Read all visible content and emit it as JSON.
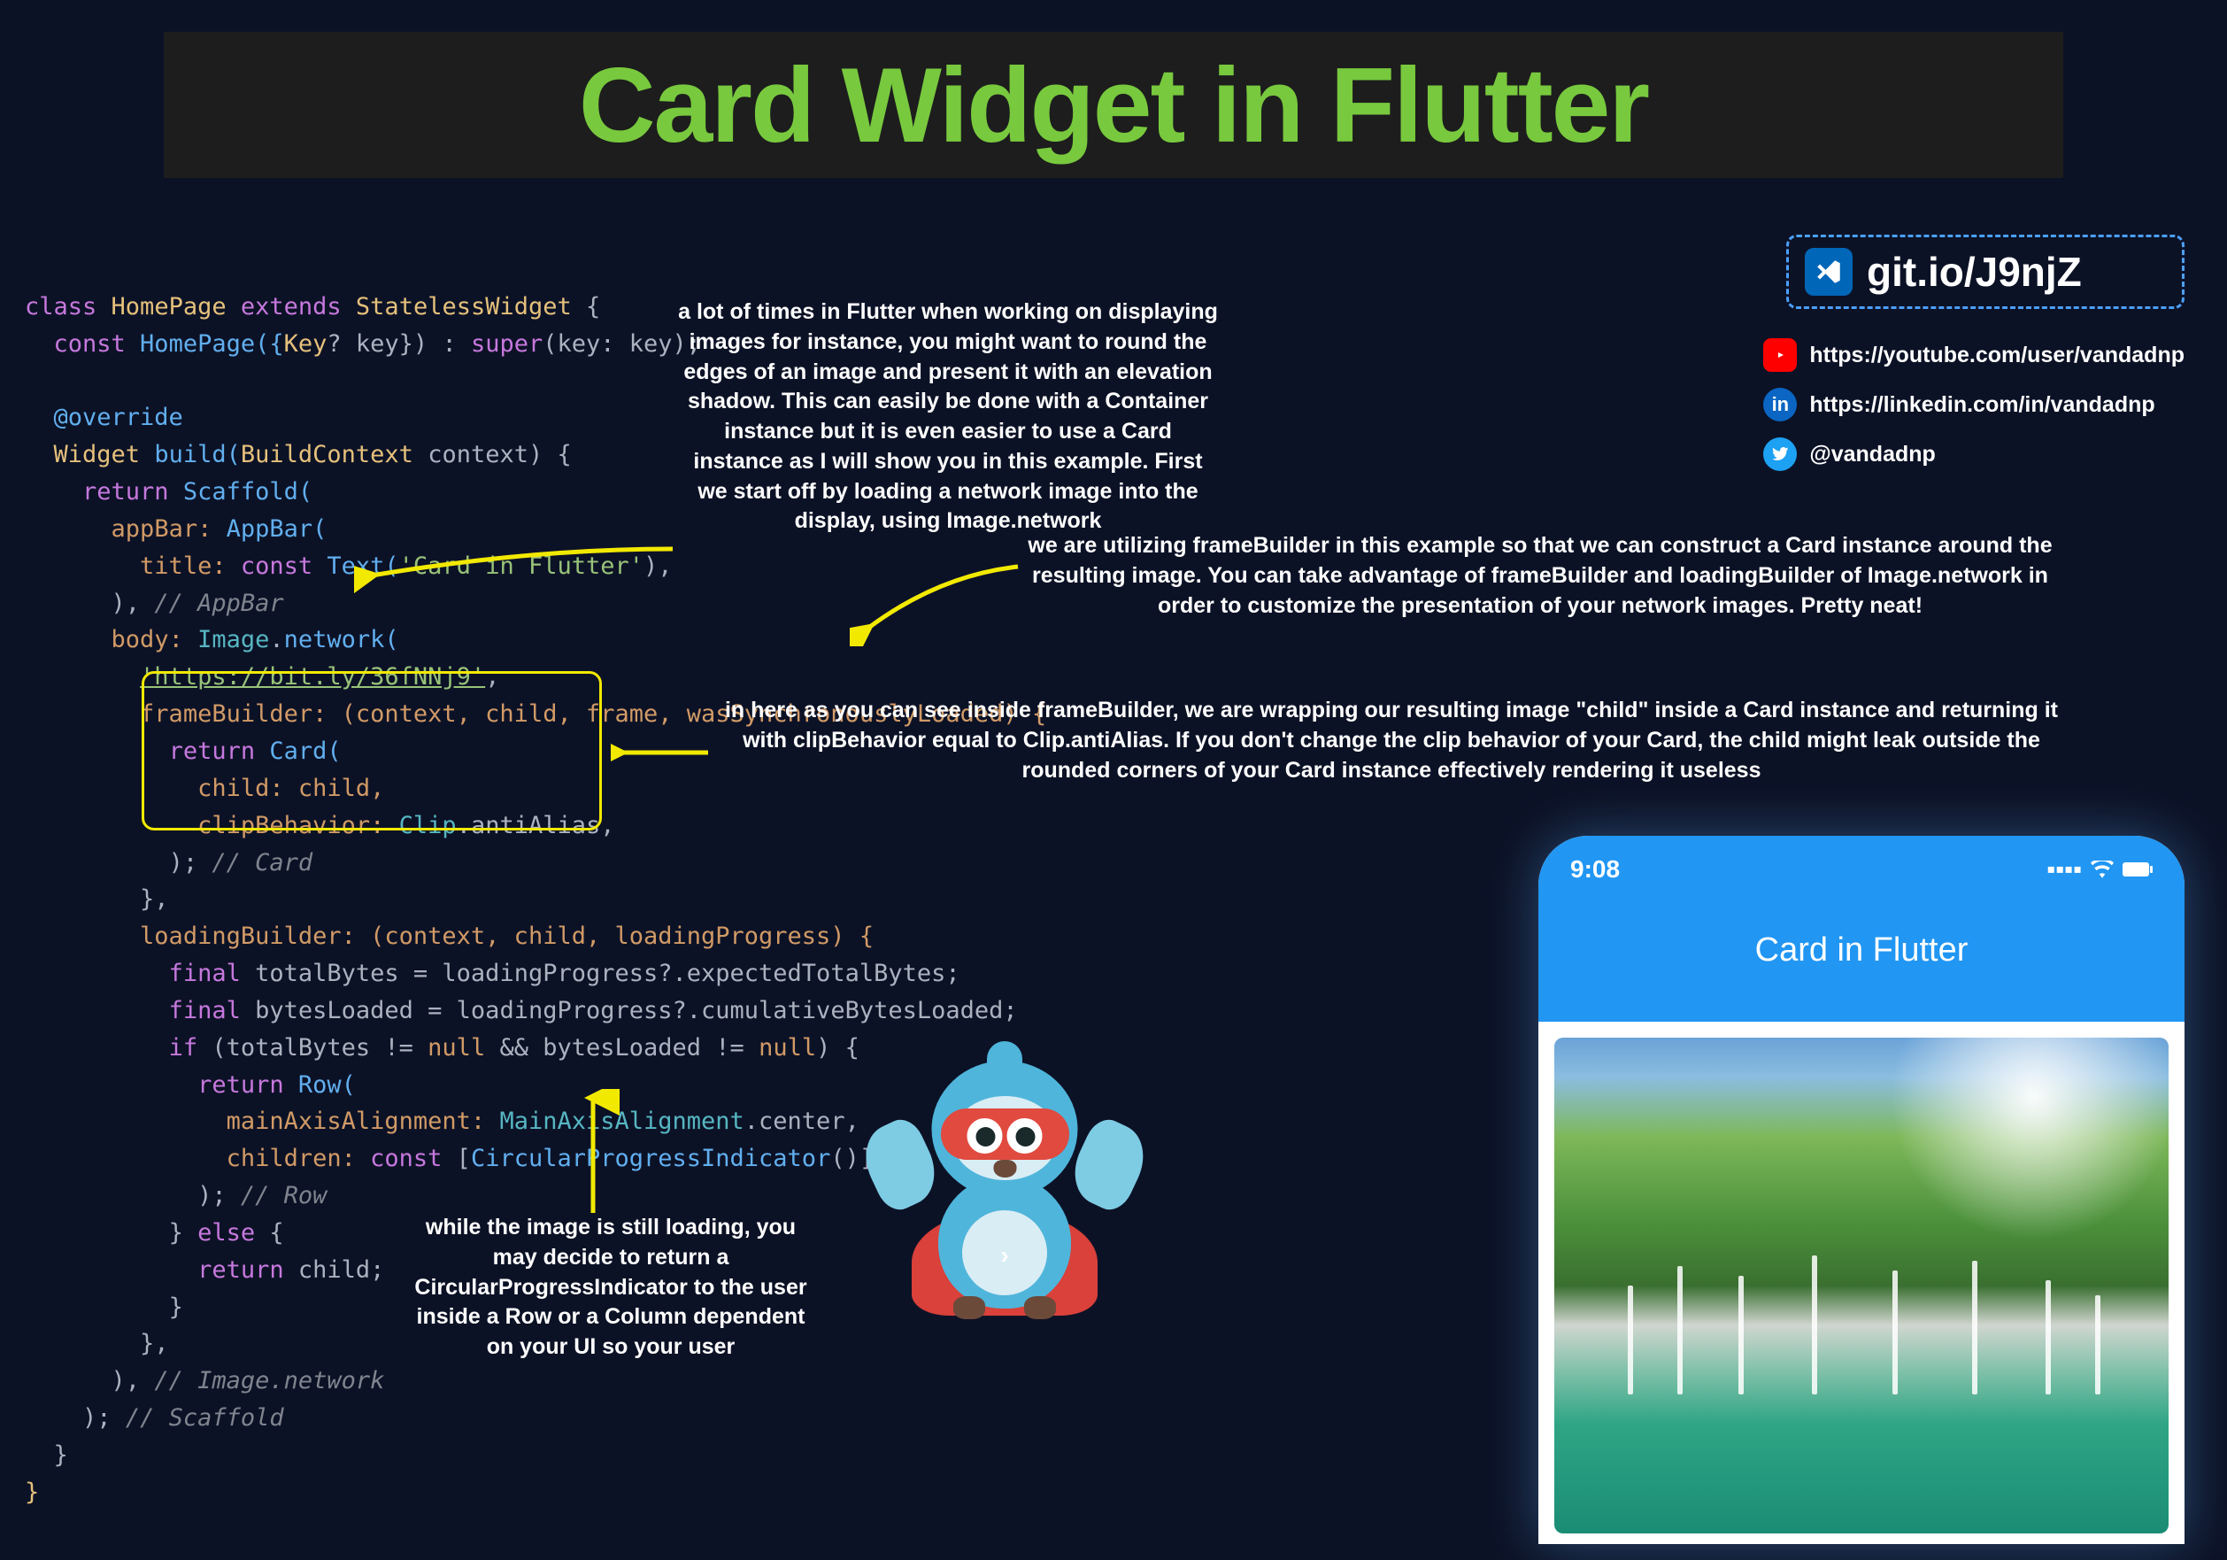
{
  "title": "Card Widget in Flutter",
  "annotations": {
    "a1": "a lot of times in Flutter when working on displaying images for instance, you might want to round the edges of an image and present it with an elevation shadow. This can easily be done with a Container instance but it is even easier to use a Card instance as I will show you in this example. First we start off by loading a network image into the display, using Image.network",
    "a2": "we are utilizing frameBuilder in this example so that we can construct a Card instance around the resulting image. You can take advantage of frameBuilder and loadingBuilder of Image.network in order to customize the presentation of your network images. Pretty neat!",
    "a3": "in here as you can see inside frameBuilder, we are wrapping our resulting image \"child\" inside a Card instance and returning it with clipBehavior equal to Clip.antiAlias. If you don't change the clip behavior of your Card, the child might leak outside the rounded corners of your Card instance effectively rendering it useless",
    "a4": "while the image is still loading, you may decide to return a CircularProgressIndicator to the user inside a Row or a Column dependent on your UI so your user"
  },
  "link_box": "git.io/J9njZ",
  "socials": {
    "youtube": "https://youtube.com/user/vandadnp",
    "linkedin": "https://linkedin.com/in/vandadnp",
    "twitter": "@vandadnp"
  },
  "phone": {
    "time": "9:08",
    "appbar_title": "Card in Flutter"
  },
  "code": {
    "l1_class": "class",
    "l1_HomePage": "HomePage",
    "l1_extends": "extends",
    "l1_Stateless": "StatelessWidget",
    "l1_brace": " {",
    "l2_const": "const",
    "l2_ctor": " HomePage({",
    "l2_Key": "Key",
    "l2_q": "?",
    "l2_key": " key}) : ",
    "l2_super": "super",
    "l2_args": "(key: key);",
    "l3": "",
    "l4_override": "@override",
    "l5_Widget": "Widget",
    "l5_build": " build(",
    "l5_BC": "BuildContext",
    "l5_ctx": " context) {",
    "l6_return": "return",
    "l6_Scaffold": " Scaffold(",
    "l7_appBar": "appBar: ",
    "l7_AppBar": "AppBar(",
    "l8_title": "title: ",
    "l8_const": "const",
    "l8_Text": " Text(",
    "l8_str": "'Card in Flutter'",
    "l8_end": "),",
    "l9_close": "), ",
    "l9_com": "// AppBar",
    "l10_body": "body: ",
    "l10_Image": "Image",
    "l10_dot": ".",
    "l10_network": "network(",
    "l11_url": "'https://bit.ly/36fNNj9'",
    "l11_comma": ",",
    "l12_fb": "frameBuilder: (context, child, frame, wasSynchronouslyLoaded) {",
    "l13_return": "return",
    "l13_Card": " Card(",
    "l14_child": "child: child,",
    "l15_clip": "clipBehavior: ",
    "l15_Clip": "Clip",
    "l15_anti": ".antiAlias,",
    "l16_close": "); ",
    "l16_com": "// Card",
    "l17_close": "},",
    "l18_lb": "loadingBuilder: (context, child, loadingProgress) {",
    "l19_final": "final",
    "l19_tb": " totalBytes = loadingProgress?.expectedTotalBytes;",
    "l20_final": "final",
    "l20_bl": " bytesLoaded = loadingProgress?.cumulativeBytesLoaded;",
    "l21_if": "if",
    "l21_cond": " (totalBytes != ",
    "l21_null1": "null",
    "l21_and": " && bytesLoaded != ",
    "l21_null2": "null",
    "l21_brace": ") {",
    "l22_return": "return",
    "l22_Row": " Row(",
    "l23_maa": "mainAxisAlignment: ",
    "l23_MAA": "MainAxisAlignment",
    "l23_center": ".center,",
    "l24_children": "children: ",
    "l24_const": "const",
    "l24_arr": " [",
    "l24_CPI": "CircularProgressIndicator",
    "l24_end": "()],",
    "l25_close": "); ",
    "l25_com": "// Row",
    "l26_else_close": "} ",
    "l26_else": "else",
    "l26_brace": " {",
    "l27_return": "return",
    "l27_child": " child;",
    "l28_close": "}",
    "l29_close": "},",
    "l30_close": "), ",
    "l30_com": "// Image.network",
    "l31_close": "); ",
    "l31_com": "// Scaffold",
    "l32_close": "}",
    "l33_close": "}"
  }
}
